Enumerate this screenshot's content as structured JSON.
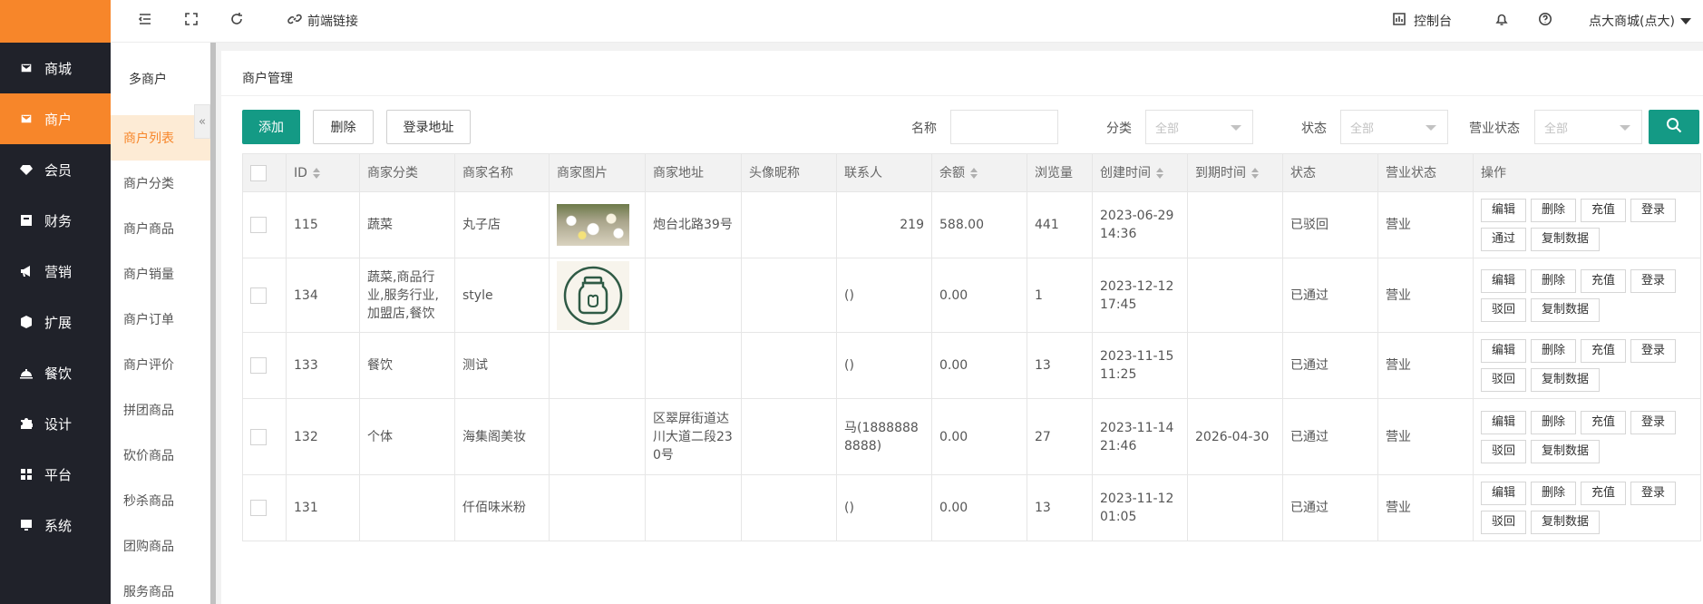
{
  "nav": {
    "items": [
      {
        "label": "商城",
        "icon": "shop-icon"
      },
      {
        "label": "商户",
        "icon": "merchant-icon"
      },
      {
        "label": "会员",
        "icon": "diamond-icon"
      },
      {
        "label": "财务",
        "icon": "wallet-icon"
      },
      {
        "label": "营销",
        "icon": "megaphone-icon"
      },
      {
        "label": "扩展",
        "icon": "cube-icon"
      },
      {
        "label": "餐饮",
        "icon": "cloche-icon"
      },
      {
        "label": "设计",
        "icon": "puzzle-icon"
      },
      {
        "label": "平台",
        "icon": "grid-icon"
      },
      {
        "label": "系统",
        "icon": "monitor-icon"
      }
    ],
    "active_index": 1,
    "accent_color": "#f7862a"
  },
  "topbar": {
    "frontend_link": "前端链接",
    "console": "控制台",
    "user": "点大商城(点大)"
  },
  "submenu": {
    "title": "多商户",
    "collapse_glyph": "«",
    "items": [
      "商户列表",
      "商户分类",
      "商户商品",
      "商户销量",
      "商户订单",
      "商户评价",
      "拼团商品",
      "砍价商品",
      "秒杀商品",
      "团购商品",
      "服务商品"
    ],
    "active_index": 0
  },
  "page": {
    "title": "商户管理",
    "buttons": {
      "add": "添加",
      "delete": "删除",
      "login_url": "登录地址"
    },
    "filters": {
      "name_label": "名称",
      "name_value": "",
      "category_label": "分类",
      "category_value": "全部",
      "status_label": "状态",
      "status_value": "全部",
      "business_label": "营业状态",
      "business_value": "全部"
    },
    "primary_color": "#149a85"
  },
  "table": {
    "columns": [
      "ID",
      "商家分类",
      "商家名称",
      "商家图片",
      "商家地址",
      "头像昵称",
      "联系人",
      "余额",
      "浏览量",
      "创建时间",
      "到期时间",
      "状态",
      "营业状态",
      "操作"
    ],
    "rows": [
      {
        "id": "115",
        "category": "蔬菜",
        "name": "丸子店",
        "image": "flower-photo",
        "address": "炮台北路39号",
        "avatar": "",
        "contact": "219",
        "balance": "588.00",
        "views": "441",
        "created": "2023-06-29 14:36",
        "expire": "",
        "status": "已驳回",
        "status_color": "red",
        "business": "营业",
        "actions": [
          "编辑",
          "删除",
          "充值",
          "登录",
          "通过",
          "复制数据"
        ]
      },
      {
        "id": "134",
        "category": "蔬菜,商品行业,服务行业,加盟店,餐饮",
        "name": "style",
        "image": "jar-logo",
        "address": "",
        "avatar": "",
        "contact": "()",
        "balance": "0.00",
        "views": "1",
        "created": "2023-12-12 17:45",
        "expire": "",
        "status": "已通过",
        "status_color": "green",
        "business": "营业",
        "actions": [
          "编辑",
          "删除",
          "充值",
          "登录",
          "驳回",
          "复制数据"
        ]
      },
      {
        "id": "133",
        "category": "餐饮",
        "name": "测试",
        "image": "",
        "address": "",
        "avatar": "",
        "contact": "()",
        "balance": "0.00",
        "views": "13",
        "created": "2023-11-15 11:25",
        "expire": "",
        "status": "已通过",
        "status_color": "green",
        "business": "营业",
        "actions": [
          "编辑",
          "删除",
          "充值",
          "登录",
          "驳回",
          "复制数据"
        ]
      },
      {
        "id": "132",
        "category": "个体",
        "name": "海集阁美妆",
        "image": "",
        "address": "区翠屏街道达川大道二段230号",
        "avatar": "",
        "contact": "马(18888888888)",
        "balance": "0.00",
        "views": "27",
        "created": "2023-11-14 21:46",
        "expire": "2026-04-30",
        "status": "已通过",
        "status_color": "green",
        "business": "营业",
        "actions": [
          "编辑",
          "删除",
          "充值",
          "登录",
          "驳回",
          "复制数据"
        ]
      },
      {
        "id": "131",
        "category": "",
        "name": "仟佰味米粉",
        "image": "",
        "address": "",
        "avatar": "",
        "contact": "()",
        "balance": "0.00",
        "views": "13",
        "created": "2023-11-12 01:05",
        "expire": "",
        "status": "已通过",
        "status_color": "green",
        "business": "营业",
        "actions": [
          "编辑",
          "删除",
          "充值",
          "登录",
          "驳回",
          "复制数据"
        ]
      }
    ]
  }
}
